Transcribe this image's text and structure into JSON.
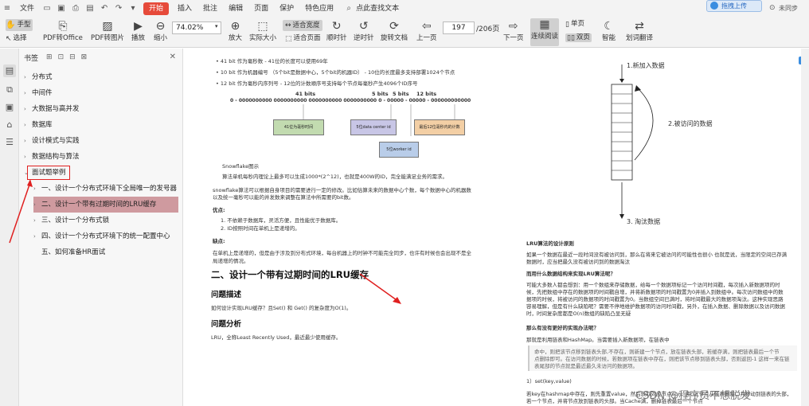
{
  "menu": {
    "file": "文件",
    "items": [
      "开始",
      "插入",
      "批注",
      "编辑",
      "页面",
      "保护",
      "特色应用"
    ],
    "active": "开始",
    "search": "点此查找文本",
    "right_btn": "拖拽上传",
    "unlogged": "未同步"
  },
  "toolbar": {
    "hand": "手型",
    "select": "选择",
    "pdf_office": "PDF转Office",
    "pdf_img": "PDF转图片",
    "play": "播放",
    "zoom_out": "缩小",
    "zoom_value": "74.02%",
    "zoom_in": "放大",
    "actual_size": "实际大小",
    "fit_width": "适合宽度",
    "fit_page": "适合页面",
    "rotate_cw": "顺时针",
    "rotate_ccw": "逆时针",
    "rotate_doc": "旋转文档",
    "prev": "上一页",
    "page_current": "197",
    "page_total": "/206页",
    "next": "下一页",
    "continuous": "连续阅读",
    "single": "单页",
    "double": "双页",
    "smart": "智能",
    "translate": "划词翻译"
  },
  "sidebar": {
    "title": "书签",
    "items": [
      {
        "label": "分布式",
        "level": 0
      },
      {
        "label": "中间件",
        "level": 0
      },
      {
        "label": "大数据与高并发",
        "level": 0
      },
      {
        "label": "数据库",
        "level": 0
      },
      {
        "label": "设计模式与实践",
        "level": 0
      },
      {
        "label": "数据结构与算法",
        "level": 0
      },
      {
        "label": "面试题举例",
        "level": 0
      },
      {
        "label": "一、设计一个分布式环境下全局唯一的发号器",
        "level": 1
      },
      {
        "label": "二、设计一个带有过期时间的LRU缓存",
        "level": 1
      },
      {
        "label": "三、设计一个分布式锁",
        "level": 1
      },
      {
        "label": "四、设计一个分布式环境下的统一配置中心",
        "level": 1
      },
      {
        "label": "五、如何准备HR面试",
        "level": 1
      }
    ]
  },
  "doc": {
    "bullets": [
      "41 bit 作为毫秒数 - 41位的长度可以使用69年",
      "10 bit 作为机器编号 （5个bit是数据中心，5个bit的机器ID） - 10位的长度最多支持部署1024个节点",
      "12 bit 作为毫秒内序列号 - 12位的计数顺序号支持每个节点每毫秒产生4096个ID序号"
    ],
    "bits_labels": [
      "41 bits",
      "5 bits",
      "5 bits",
      "12 bits"
    ],
    "bits_row": "0 - 0000000000 0000000000 0000000000 0000000000 0 - 00000 - 00000 - 000000000000",
    "box1": "41位为毫秒时间",
    "box2": "5位data center id",
    "box3": "5位worker id",
    "box4": "最后12位毫秒内的计数",
    "fig_caption": "Snowflake图示",
    "p1": "算法单机每秒内理论上最多可以生成1000*(2^12)，也就是400W的ID，完全能满足业务的需求。",
    "p2a": "snowflake算法可以根据自身项目的需要进行一定的修改。比如估算未来的数据中心个数，每个数据中心的机器数",
    "p2b": "以及统一毫秒可以能的并发数来调整在算法中所需要的bit数。",
    "adv": "优点:",
    "adv1": "1. 不依赖于数据库，灵活方便，且性能优于数据库。",
    "adv2": "2. ID按照时间在单机上是递增的。",
    "dis": "缺点:",
    "dis1": "在单机上是递增的，但是由于涉及到分布式环境，每台机器上的时钟不可能完全同步，也许有时候也会出现不是全",
    "dis2": "局递增的情况。",
    "h_lru": "二、设计一个带有过期时间的LRU缓存",
    "h_desc": "问题描述",
    "desc": "如何设计实现LRU缓存？且Set() 和 Get() 的复杂度为O(1)。",
    "h_ana": "问题分析",
    "ana": "LRU，全称Least Recently Used，最近最少使用缓存。",
    "fig_new": "1.新加入数据",
    "fig_access": "2.被访问的数据",
    "fig_evict": "3. 淘汰数据",
    "r_h1": "LRU算法的设计原则",
    "r_p1": [
      "如果一个数据在最近一段时间没有被访问到，那么在将来它被访问的可能性也很小 也就是说，当限定的空间已存满",
      "数据时，应当把最久没有被访问到的数据淘汰"
    ],
    "r_h2": "而用什么数据结构来实现LRU算法呢？",
    "r_p2": [
      "可能大多数人都会想到：用一个数组来存储数据，给每一个数据项标记一个访问时间戳，每次插入新数据项的时",
      "候，先把数组中存在的数据项的时间戳自增，并将新数据项的时间戳置为0并插入到数组中。每次访问数组中的数",
      "据项的时候，将被访问的数据项的时间戳置为0。当数组空间已满时，将时间戳最大的数据项淘汰。这种实现思路",
      "容易理解，但是有什么缺陷呢？需要不停地维护数据项的访问时间戳，另外，在插入数据、删除数据以及访问数据",
      "时，时间复杂度都是O(n)数组的缺陷凸显无疑"
    ],
    "r_h3": "那么有没有更好的实现办法呢？",
    "r_p3": "那就是利用链表和HashMap。当需要插入新数据项，在链表中",
    "r_q": [
      "命中，则把该节点移到链表头部,不存在，则新建一个节点，放在链表头部，若缓存满，则把链表最后一个节",
      "点删除即可。在访问数据的时候，若数据项在链表中存在，则把该节点移到链表头部，否则返回-1 这样一来在链",
      "表尾部的节点就是最近最久未访问的数据项。"
    ],
    "r_set": "1）set(key,value)",
    "r_p4": [
      "若key在hashmap中存在，则先重置value，然后获取对应节点cur，将cur节点从链表删除，并移动到链表的头部，",
      "若一个节点，并将节点放到链表的头部。当Cache满，删掉链表最后一个节点"
    ]
  },
  "watermark": "CSDN @程序员不想脱发"
}
